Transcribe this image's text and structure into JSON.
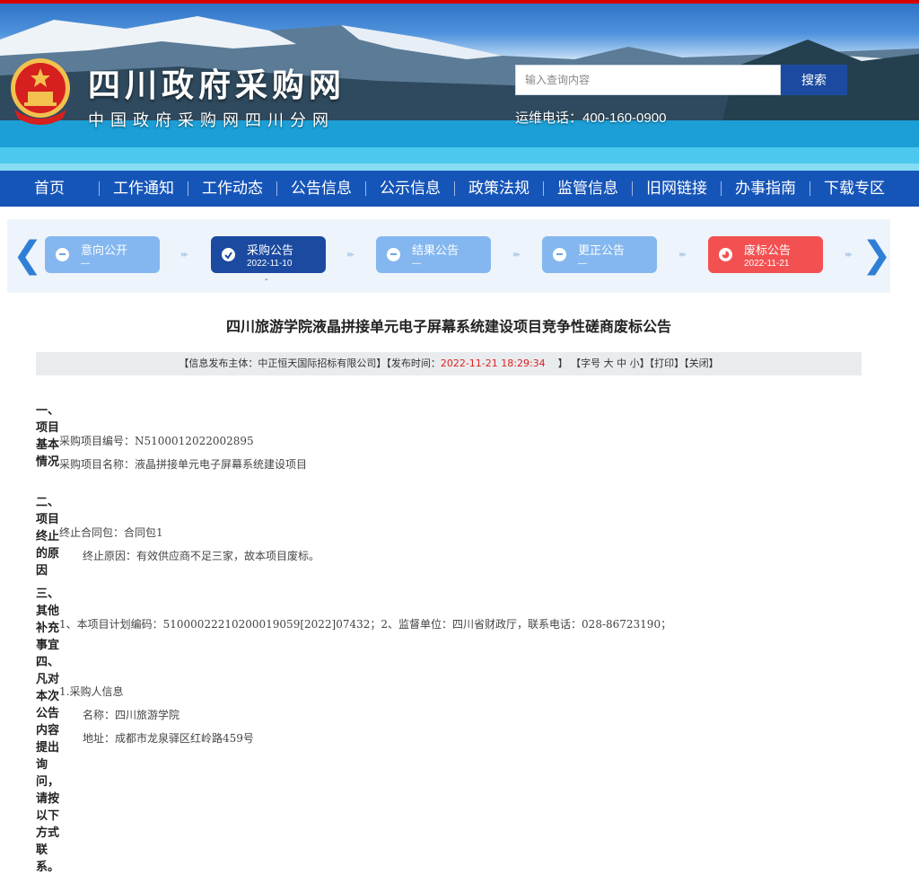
{
  "header": {
    "site_title": "四川政府采购网",
    "site_subtitle": "中国政府采购网四川分网",
    "search_placeholder": "输入查询内容",
    "search_button": "搜索",
    "hotline": "运维电话：400-160-0900"
  },
  "nav": {
    "items": [
      "首页",
      "工作通知",
      "工作动态",
      "公告信息",
      "公示信息",
      "政策法规",
      "监管信息",
      "旧网链接",
      "办事指南",
      "下载专区"
    ]
  },
  "stepper": {
    "steps": [
      {
        "label": "意向公开",
        "date": "—",
        "state": "inactive"
      },
      {
        "label": "采购公告",
        "date": "2022-11-10",
        "state": "done"
      },
      {
        "label": "结果公告",
        "date": "—",
        "state": "inactive"
      },
      {
        "label": "更正公告",
        "date": "—",
        "state": "inactive"
      },
      {
        "label": "废标公告",
        "date": "2022-11-21",
        "state": "current"
      }
    ],
    "below_mark": "-"
  },
  "article": {
    "title": "四川旅游学院液晶拼接单元电子屏幕系统建设项目竞争性磋商废标公告",
    "meta": {
      "publisher_prefix": "【信息发布主体：中正恒天国际招标有限公司】【发布时间：",
      "publish_time": "2022-11-21 18:29:34",
      "time_suffix": "】",
      "font_size_label": "【字号 大 中 小】",
      "print_label": "【打印】",
      "close_label": "【关闭】"
    },
    "sections": {
      "s1_heading": "一、项目基本情况",
      "s1_line1": "采购项目编号：N5100012022002895",
      "s1_line2": "采购项目名称：液晶拼接单元电子屏幕系统建设项目",
      "s2_heading": "二、项目终止的原因",
      "s2_line1": "终止合同包：合同包1",
      "s2_line2": "终止原因：有效供应商不足三家，故本项目废标。",
      "s3_heading": "三、其他补充事宜",
      "s3_line1": "1、本项目计划编码：51000022210200019059[2022]07432；2、监督单位：四川省财政厅，联系电话：028-86723190；",
      "s4_heading": "四、凡对本次公告内容提出询问，请按以下方式联系。",
      "s4_line1": "1.采购人信息",
      "s4_line2": "名称：四川旅游学院",
      "s4_line3": "地址：成都市龙泉驿区红岭路459号"
    }
  },
  "colors": {
    "top_line": "#d40000",
    "nav_bg": "#1655b8",
    "step_active": "#1b4aa0",
    "step_inactive": "#84b7ef",
    "step_current": "#f35151",
    "time_red": "#e02020"
  }
}
